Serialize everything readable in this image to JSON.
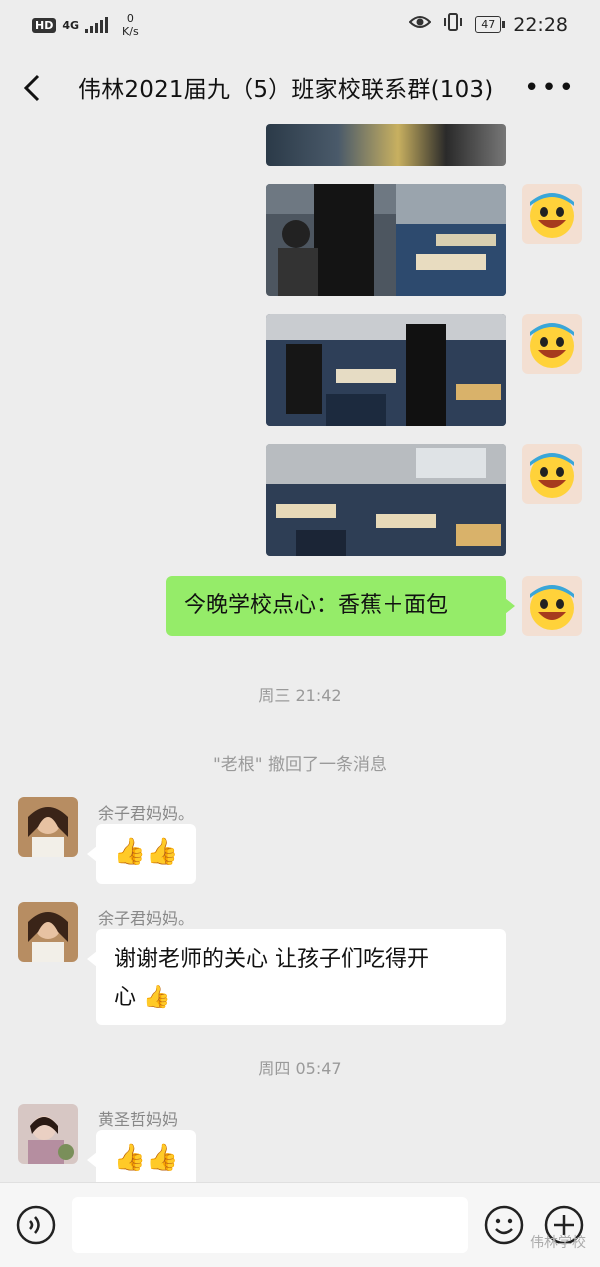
{
  "status_bar": {
    "network_badge": "HD",
    "network_type": "4G",
    "speed_value": "0",
    "speed_unit": "K/s",
    "battery": "47",
    "time": "22:28"
  },
  "header": {
    "title": "伟林2021届九（5）班家校联系群(103)",
    "back_icon": "back-chevron-icon",
    "more_icon": "more-dots-icon"
  },
  "messages": {
    "outgoing_text": "今晚学校点心：香蕉＋面包",
    "time_1": "周三 21:42",
    "recall_notice": "\"老根\" 撤回了一条消息",
    "msg1_sender": "余子君妈妈。",
    "msg1_text": "👍👍",
    "msg2_sender": "余子君妈妈。",
    "msg2_line1": "谢谢老师的关心 让孩子们吃得开",
    "msg2_line2": "心 👍",
    "time_2": "周四 05:47",
    "msg3_sender": "黄圣哲妈妈",
    "msg3_text": "👍👍"
  },
  "input_bar": {
    "voice_icon": "voice-icon",
    "emoji_icon": "emoji-icon",
    "plus_icon": "plus-icon"
  },
  "watermark": "伟林学校",
  "colors": {
    "background": "#ededed",
    "outgoing_bubble": "#95ec69",
    "incoming_bubble": "#ffffff"
  }
}
